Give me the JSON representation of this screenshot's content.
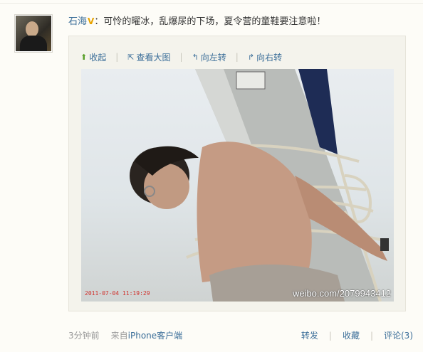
{
  "post": {
    "author": "石海",
    "verified_badge": "V",
    "separator": "：",
    "text": "可怜的曜冰，乱爆尿的下场，夏令营的童鞋要注意啦！"
  },
  "toolbar": {
    "collapse": "收起",
    "view_large": "查看大图",
    "rotate_left": "向左转",
    "rotate_right": "向右转"
  },
  "photo": {
    "watermark": "weibo.com/2079943412",
    "timestamp": "2011-07-04 11:19:29"
  },
  "footer": {
    "time": "3分钟前",
    "source_prefix": "来自",
    "source": "iPhone客户端",
    "repost": "转发",
    "favorite": "收藏",
    "comment": "评论(3)"
  },
  "colors": {
    "link": "#3b6e99",
    "badge": "#e8a300",
    "background": "#fdfcf7",
    "quote_bg": "#f4f3ec"
  },
  "icons": {
    "collapse": "arrow-up-icon",
    "view_large": "zoom-icon",
    "rotate_left": "rotate-left-icon",
    "rotate_right": "rotate-right-icon"
  }
}
